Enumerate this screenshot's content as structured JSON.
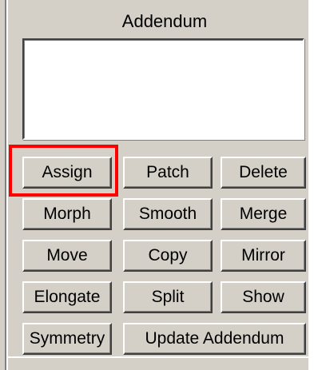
{
  "panel": {
    "title": "Addendum",
    "text_value": ""
  },
  "buttons": {
    "assign": "Assign",
    "patch": "Patch",
    "delete": "Delete",
    "morph": "Morph",
    "smooth": "Smooth",
    "merge": "Merge",
    "move": "Move",
    "copy": "Copy",
    "mirror": "Mirror",
    "elongate": "Elongate",
    "split": "Split",
    "show": "Show",
    "symmetry": "Symmetry",
    "update_addendum": "Update Addendum"
  },
  "annotation": {
    "highlight_color": "#ff0000",
    "highlighted_button": "Assign"
  }
}
